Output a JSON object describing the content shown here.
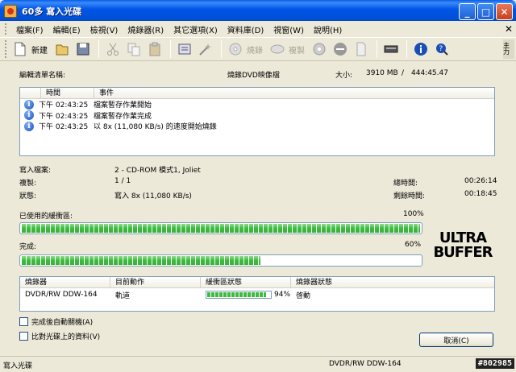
{
  "window": {
    "title": "60多 寫入光碟"
  },
  "menu": {
    "items": [
      "檔案(F)",
      "編輯(E)",
      "檢視(V)",
      "燒錄器(R)",
      "其它選項(X)",
      "資料庫(D)",
      "視窗(W)",
      "說明(H)"
    ]
  },
  "toolbar": {
    "new_label": "新建",
    "burn_label": "燒錄",
    "copy_label": "複製",
    "end_label": "主力"
  },
  "summary": {
    "compilation_label": "編輯清單名稱:",
    "compilation_value": "燒錄DVD映像檔",
    "size_label": "大小:",
    "size_value": "3910 MB",
    "size_sep": "/",
    "size_total": "444:45.47"
  },
  "log": {
    "col_time": "時間",
    "col_event": "事件",
    "rows": [
      {
        "time": "下午 02:43:25",
        "event": "檔案暫存作業開始"
      },
      {
        "time": "下午 02:43:25",
        "event": "檔案暫存作業完成"
      },
      {
        "time": "下午 02:43:25",
        "event": "以 8x (11,080 KB/s) 的速度開始燒錄"
      }
    ]
  },
  "details": {
    "write_label": "寫入檔案:",
    "write_value": "2 - CD-ROM 模式1, Joliet",
    "copies_label": "複製:",
    "copies_value": "1 / 1",
    "total_time_label": "總時間:",
    "total_time_value": "00:26:14",
    "state_label": "狀態:",
    "state_value": "寫入 8x (11,080 KB/s)",
    "remaining_label": "剩餘時間:",
    "remaining_value": "00:18:45"
  },
  "buffer": {
    "label": "已使用的緩衝區:",
    "percent_text": "100%",
    "level": 1.0
  },
  "progress": {
    "label": "完成:",
    "percent_text": "60%",
    "level": 0.6
  },
  "logo": {
    "line1": "ULTRA",
    "line2": "BUFFER"
  },
  "status_table": {
    "col_recorder": "燒錄器",
    "col_action": "目前動作",
    "col_buffer": "緩衝區狀態",
    "col_state": "燒錄器狀態",
    "row": {
      "recorder": "DVDR/RW DDW-164",
      "action": "軌道",
      "buffer_text": "94%",
      "buffer_level": 0.94,
      "state": "啓動"
    }
  },
  "options": {
    "shutdown_label": "完成後自動關機(A)",
    "verify_label": "比對光碟上的資料(V)"
  },
  "cancel_label": "取消(C)",
  "statusbar": {
    "left": "寫入光碟",
    "drive": "DVDR/RW  DDW-164",
    "watermark": "#802985"
  },
  "colors": {
    "titlebar": "#0054e3",
    "progress_green": "#3dbb3d",
    "panel": "#ece9d8"
  }
}
